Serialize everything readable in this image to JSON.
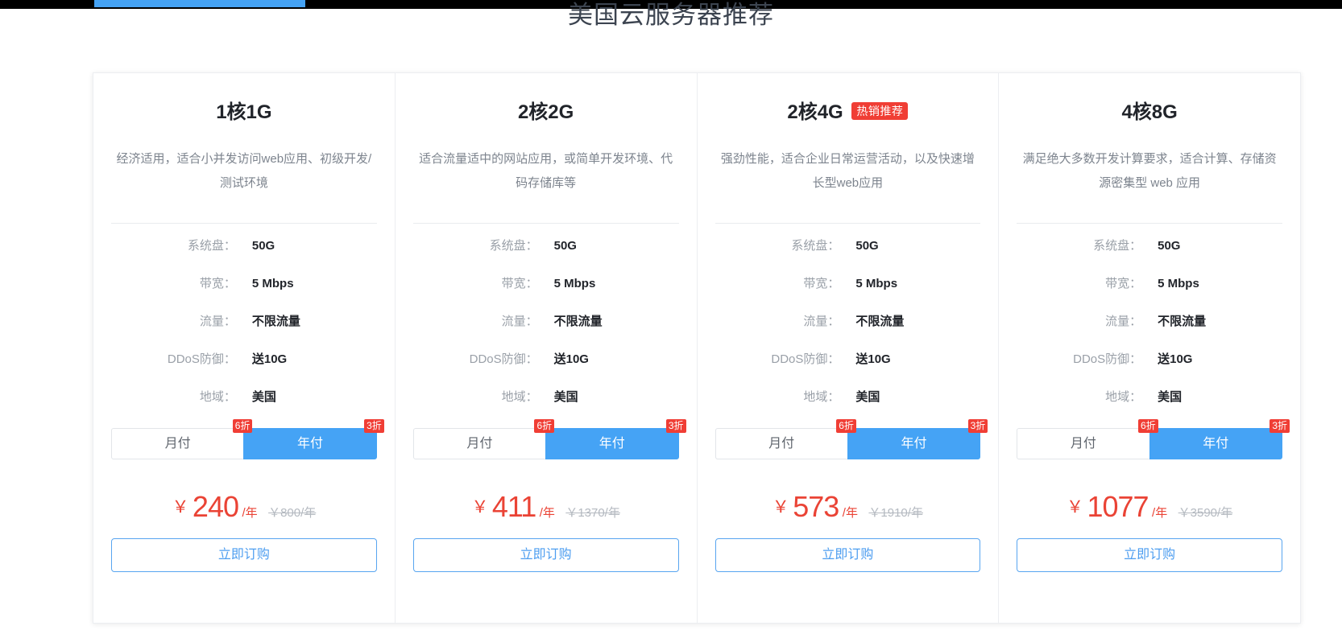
{
  "top_bar": {
    "indicator_color": "#45a3f5",
    "background_color": "#000000"
  },
  "header": {
    "title": "美国云服务器推荐"
  },
  "colors": {
    "accent_blue": "#45a3f5",
    "price_red": "#ea4335",
    "badge_red": "#f03e35",
    "label_grey": "#9aa0a8"
  },
  "spec_labels": {
    "disk": "系统盘：",
    "bandwidth": "带宽：",
    "traffic": "流量：",
    "ddos": "DDoS防御：",
    "region": "地域："
  },
  "billing": {
    "monthly_label": "月付",
    "monthly_discount": "6折",
    "yearly_label": "年付",
    "yearly_discount": "3折",
    "selected": "年付"
  },
  "order_button_label": "立即订购",
  "plans": [
    {
      "title": "1核1G",
      "badge": "",
      "desc": "经济适用，适合小并发访问web应用、初级开发/测试环境",
      "disk": "50G",
      "bandwidth": "5 Mbps",
      "traffic": "不限流量",
      "ddos": "送10G",
      "region": "美国",
      "currency": "￥",
      "price": "240",
      "price_unit": "/年",
      "original_price": "￥800/年"
    },
    {
      "title": "2核2G",
      "badge": "",
      "desc": "适合流量适中的网站应用，或简单开发环境、代码存储库等",
      "disk": "50G",
      "bandwidth": "5 Mbps",
      "traffic": "不限流量",
      "ddos": "送10G",
      "region": "美国",
      "currency": "￥",
      "price": "411",
      "price_unit": "/年",
      "original_price": "￥1370/年"
    },
    {
      "title": "2核4G",
      "badge": "热销推荐",
      "desc": "强劲性能，适合企业日常运营活动，以及快速增长型web应用",
      "disk": "50G",
      "bandwidth": "5 Mbps",
      "traffic": "不限流量",
      "ddos": "送10G",
      "region": "美国",
      "currency": "￥",
      "price": "573",
      "price_unit": "/年",
      "original_price": "￥1910/年"
    },
    {
      "title": "4核8G",
      "badge": "",
      "desc": "满足绝大多数开发计算要求，适合计算、存储资源密集型 web 应用",
      "disk": "50G",
      "bandwidth": "5 Mbps",
      "traffic": "不限流量",
      "ddos": "送10G",
      "region": "美国",
      "currency": "￥",
      "price": "1077",
      "price_unit": "/年",
      "original_price": "￥3590/年"
    }
  ]
}
